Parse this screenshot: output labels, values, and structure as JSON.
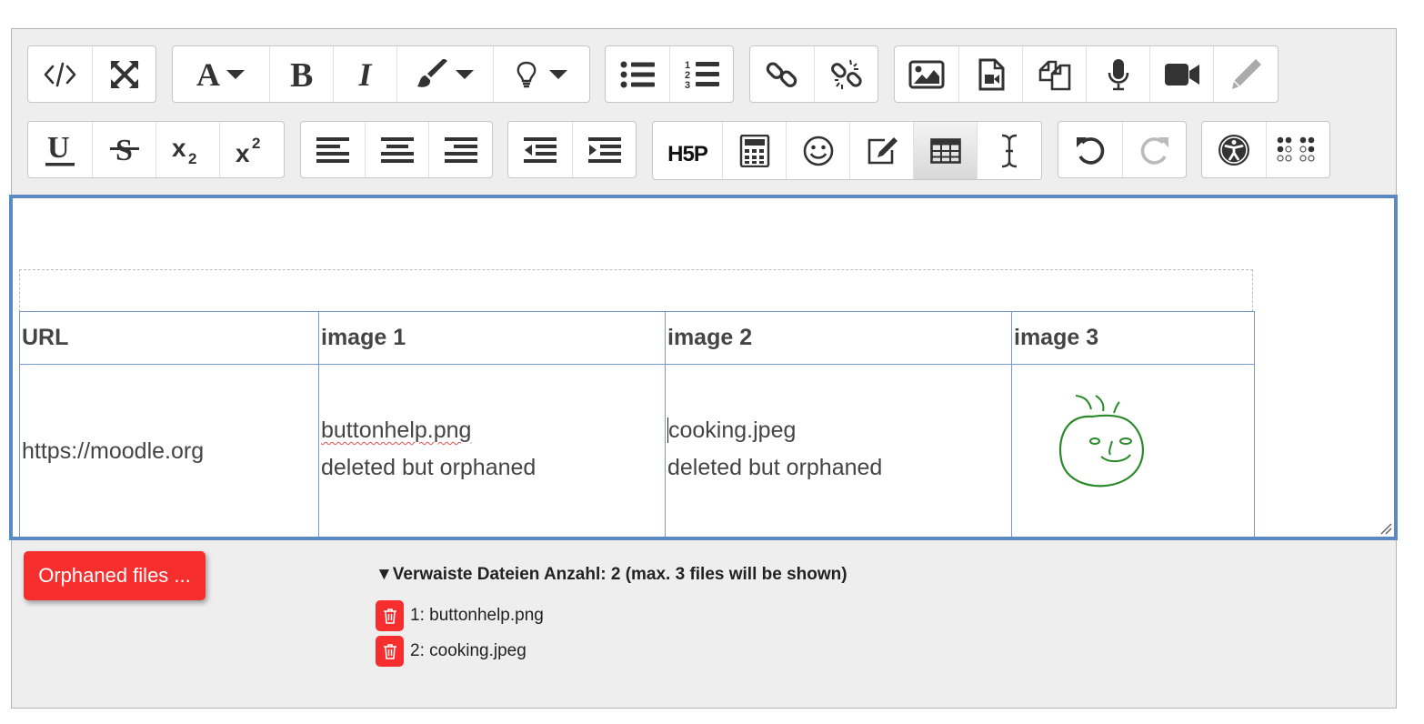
{
  "toolbar": {
    "row1": [
      {
        "group": "view",
        "buttons": [
          "html-icon",
          "fullscreen-icon"
        ]
      },
      {
        "group": "style",
        "buttons": [
          "font-style-icon",
          "bold-icon",
          "italic-icon",
          "font-color-icon",
          "tips-icon"
        ]
      },
      {
        "group": "lists",
        "buttons": [
          "bullet-list-icon",
          "numbered-list-icon"
        ]
      },
      {
        "group": "links",
        "buttons": [
          "link-icon",
          "unlink-icon"
        ]
      },
      {
        "group": "media",
        "buttons": [
          "image-icon",
          "media-icon",
          "manage-files-icon",
          "record-audio-icon",
          "record-video-icon",
          "pencil-icon"
        ]
      }
    ],
    "row2": [
      {
        "group": "text",
        "buttons": [
          "underline-icon",
          "strikethrough-icon",
          "subscript-icon",
          "superscript-icon"
        ]
      },
      {
        "group": "align",
        "buttons": [
          "align-left-icon",
          "align-center-icon",
          "align-right-icon"
        ]
      },
      {
        "group": "indent",
        "buttons": [
          "outdent-icon",
          "indent-icon"
        ]
      },
      {
        "group": "insert",
        "buttons": [
          "h5p-icon",
          "calculator-icon",
          "emoji-icon",
          "draw-icon",
          "table-icon",
          "text-cursor-icon"
        ]
      },
      {
        "group": "history",
        "buttons": [
          "undo-icon",
          "redo-icon"
        ]
      },
      {
        "group": "accessibility",
        "buttons": [
          "accessibility-icon",
          "braille-icon"
        ]
      }
    ]
  },
  "labels": {
    "italic": "I",
    "h5p": "H5P",
    "font_a": "A"
  },
  "table": {
    "headers": [
      "URL",
      "image 1",
      "image 2",
      "image 3"
    ],
    "row": {
      "url": "https://moodle.org",
      "image1_file": "buttonhelp.png",
      "image1_note": "deleted but orphaned",
      "image2_file": "cooking.jpeg",
      "image2_note": "deleted but orphaned"
    }
  },
  "orphaned": {
    "button_label": "Orphaned files ...",
    "title": "▼Verwaiste Dateien Anzahl: 2 (max. 3 files will be shown)",
    "files": [
      "1: buttonhelp.png",
      "2: cooking.jpeg"
    ]
  },
  "colors": {
    "accent_red": "#f62e2e",
    "focus_border": "#5b8ac2",
    "table_border": "#7897cc",
    "drawing_green": "#2a8a2a"
  }
}
